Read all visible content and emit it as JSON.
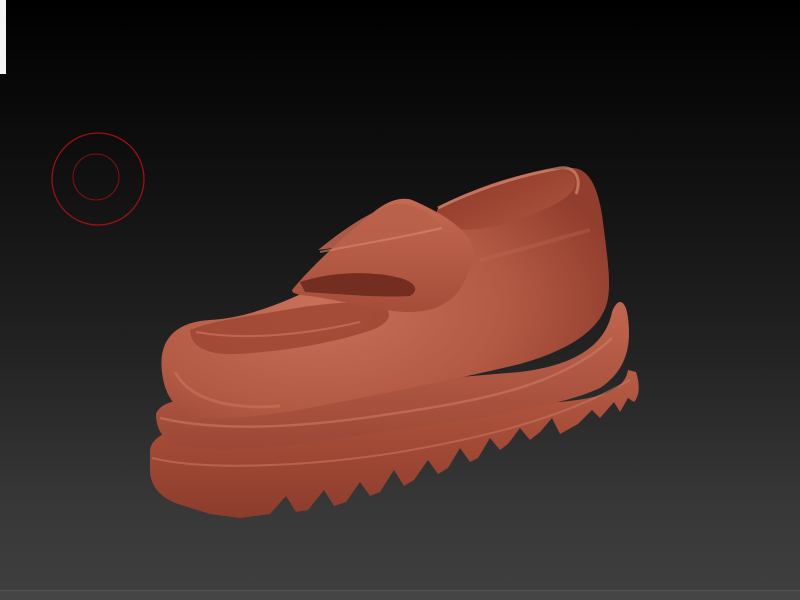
{
  "viewport": {
    "background_top": "#000000",
    "background_bottom": "#3f3f3f"
  },
  "brush_cursor": {
    "icon": "brush-circle-icon",
    "color": "#b01010"
  },
  "model": {
    "object": "loafer-shoe",
    "material_color": "#b0563f",
    "shadow_color": "#6e2a1e",
    "highlight_color": "#d07a62"
  },
  "corner_panel": {
    "color": "#f4f4f4"
  }
}
